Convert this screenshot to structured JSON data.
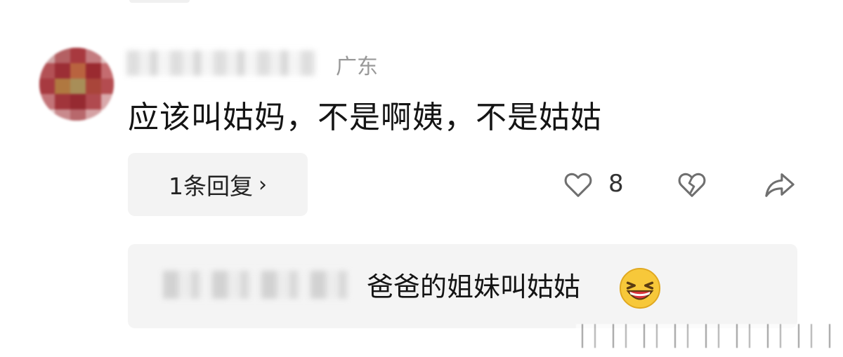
{
  "comment": {
    "location": "广东",
    "text": "应该叫姑妈，不是啊姨，不是姑姑",
    "reply_button_label": "1条回复",
    "reply_button_chevron": "›",
    "like_count": "8",
    "icons": {
      "like": "heart-outline-icon",
      "dislike": "broken-heart-icon",
      "share": "share-arrow-icon"
    }
  },
  "sub_reply": {
    "text": "爸爸的姐妹叫姑姑",
    "emoji": "grinning-squinting-face-emoji"
  },
  "colors": {
    "background": "#ffffff",
    "bubble": "#f3f3f3",
    "text": "#141414",
    "muted": "#999999",
    "icon": "#6f6f6f"
  }
}
